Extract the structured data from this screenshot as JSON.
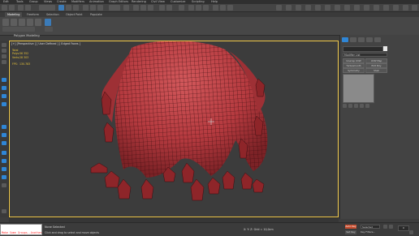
{
  "menubar": {
    "items": [
      "Edit",
      "Tools",
      "Group",
      "Views",
      "Create",
      "Modifiers",
      "Animation",
      "Graph Editors",
      "Rendering",
      "Civil View",
      "Customize",
      "Scripting",
      "Help"
    ]
  },
  "ribbon": {
    "tabs": [
      "Modeling",
      "Freeform",
      "Selection",
      "Object Paint",
      "Populate"
    ],
    "active_tab": "Modeling",
    "panel_label": "Polygon Modeling"
  },
  "viewport": {
    "label": "[+] [Perspective ] [ User Defined ] [ Edged Faces ]",
    "stats": {
      "header": "Total",
      "polys_label": "Polys:",
      "polys_value": "56 352",
      "verts_label": "Verts:",
      "verts_value": "28 303",
      "fps_label": "FPS:",
      "fps_value": "130.783"
    },
    "mesh_color": "#b53a3f",
    "border_color": "#f0c94a"
  },
  "command_panel": {
    "modifier_list": "Modifier List",
    "buttons": [
      "Unwrap UVW",
      "UVW Map",
      "Turbosmooth",
      "Edit Poly",
      "Symmetry",
      "Shell"
    ]
  },
  "statusbar": {
    "maxscript": "Make Some Groups--Another",
    "status_line1": "None Selected",
    "status_line2": "Click and drag to select and move objects",
    "coords": "X:   Y:   Z:   Grid = 10,0cm",
    "auto_key": "Auto Key",
    "selected": "Selected",
    "set_key": "Set Key",
    "key_filters": "Key Filters...",
    "frame": "0"
  },
  "colors": {
    "accent": "#2f86d6",
    "cloth": "#b53a3f",
    "autokey": "#c44b2d"
  }
}
